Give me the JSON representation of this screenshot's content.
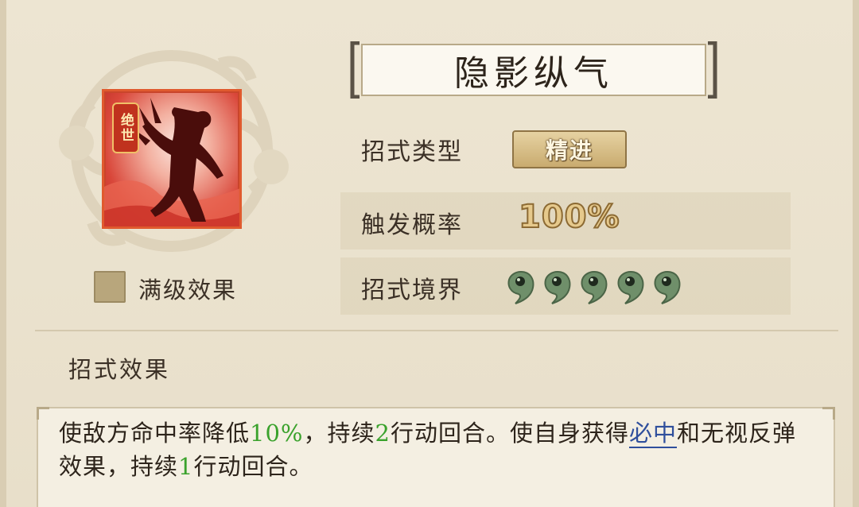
{
  "skill": {
    "name": "隐影纵气",
    "rank_badge": "绝世",
    "icon": "shadow-figure-icon"
  },
  "max_level": {
    "label": "满级效果",
    "checked": false
  },
  "attributes": {
    "type_label": "招式类型",
    "type_value": "精进",
    "rate_label": "触发概率",
    "rate_value": "100%",
    "realm_label": "招式境界",
    "realm_level": 5,
    "realm_icon": "magatama-icon"
  },
  "effect": {
    "heading": "招式效果",
    "desc_part1": "使敌方命中率降低",
    "desc_val1": "10%",
    "desc_part2": "，持续",
    "desc_val2": "2",
    "desc_part3": "行动回合。使自身获得",
    "desc_link": "必中",
    "desc_part4": "和无视反弹效果，持续",
    "desc_val3": "1",
    "desc_part5": "行动回合。"
  },
  "colors": {
    "highlight_value": "#3aa22c",
    "link": "#2f4f9c",
    "icon_frame": "#e05a2e"
  }
}
